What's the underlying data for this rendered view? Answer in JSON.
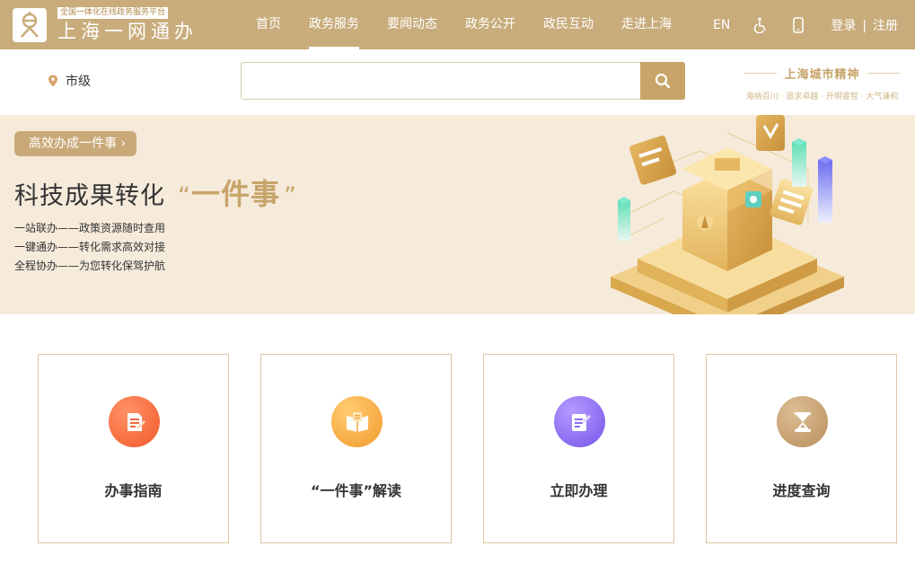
{
  "header": {
    "logo_tag": "全国一体化在线政务服务平台",
    "logo_title": "上海一网通办",
    "nav": [
      {
        "label": "首页"
      },
      {
        "label": "政务服务"
      },
      {
        "label": "要闻动态"
      },
      {
        "label": "政务公开"
      },
      {
        "label": "政民互动"
      },
      {
        "label": "走进上海"
      }
    ],
    "active_nav": "政务服务",
    "lang_label": "EN",
    "accessibility_icon": "wheelchair-icon",
    "mobile_icon": "mobile-phone-icon",
    "login_label": "登录",
    "auth_separator": "|",
    "register_label": "注册",
    "bar_color": "#c8ac7b"
  },
  "search": {
    "location_label": "市级",
    "location_icon": "map-pin-icon",
    "value": "",
    "button_icon": "search-icon"
  },
  "spirit": {
    "title": "上海城市精神",
    "subtitle": "海纳百川 · 追求卓越 · 开明睿智 · 大气谦和"
  },
  "banner": {
    "pill_label": "高效办成一件事 ›",
    "title_main": "科技成果转化",
    "title_quote_open": "“",
    "title_highlight": "一件事",
    "title_quote_close": "”",
    "lines": [
      "一站联办——政策资源随时查用",
      "一键通办——转化需求高效对接",
      "全程协办——为您转化保驾护航"
    ],
    "background_color": "#f6ebdb",
    "accent_color": "#c6a46a"
  },
  "cards": [
    {
      "label": "办事指南",
      "icon": "guide-document-icon",
      "color": "#f26a3c"
    },
    {
      "label": "“一件事”解读",
      "icon": "open-book-icon",
      "color": "#f6a73e"
    },
    {
      "label": "立即办理",
      "icon": "edit-form-icon",
      "color": "#8a6cf0"
    },
    {
      "label": "进度查询",
      "icon": "hourglass-icon",
      "color": "#c9a072"
    }
  ]
}
